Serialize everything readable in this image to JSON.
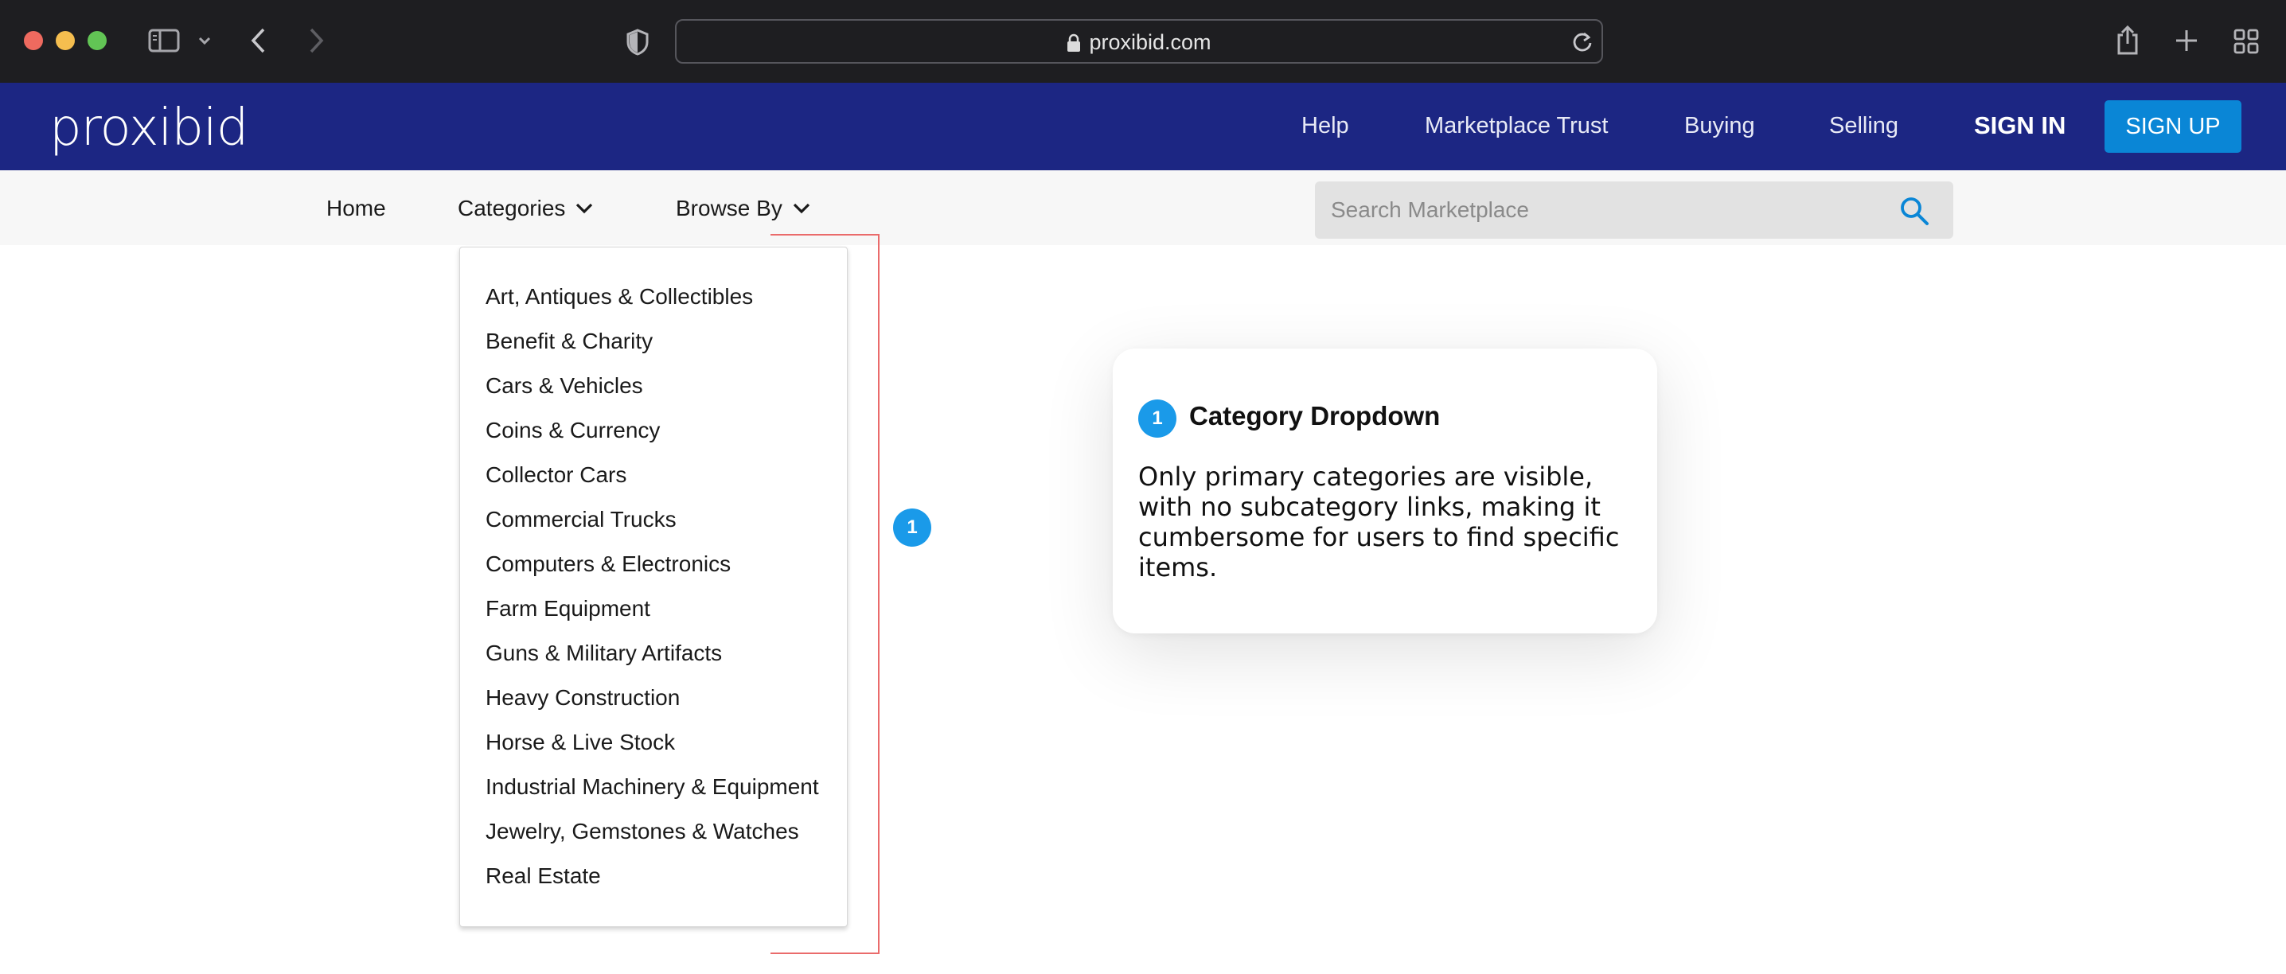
{
  "browser": {
    "url": "proxibid.com",
    "icons": [
      "close-icon",
      "minimize-icon",
      "zoom-icon",
      "sidebar-icon",
      "chevron-down-icon",
      "back-icon",
      "forward-icon",
      "shield-icon",
      "lock-icon",
      "reload-icon",
      "share-icon",
      "new-tab-icon",
      "tab-overview-icon"
    ]
  },
  "header": {
    "logo": "proxibid",
    "nav": [
      "Help",
      "Marketplace Trust",
      "Buying",
      "Selling"
    ],
    "sign_in": "SIGN IN",
    "sign_up": "SIGN UP",
    "background_color": "#1c2683",
    "button_color": "#0a86d6"
  },
  "subnav": {
    "home": "Home",
    "categories": "Categories",
    "browse_by": "Browse By",
    "search_placeholder": "Search Marketplace"
  },
  "dropdown": {
    "items": [
      "Art, Antiques & Collectibles",
      "Benefit & Charity",
      "Cars & Vehicles",
      "Coins & Currency",
      "Collector Cars",
      "Commercial Trucks",
      "Computers & Electronics",
      "Farm Equipment",
      "Guns & Military Artifacts",
      "Heavy Construction",
      "Horse & Live Stock",
      "Industrial Machinery & Equipment",
      "Jewelry, Gemstones & Watches",
      "Real Estate"
    ]
  },
  "annotation": {
    "number": "1",
    "title": "Category Dropdown",
    "body": "Only primary categories are visible, with no subcategory links, making it cumbersome for users to find specific items.",
    "marker_color": "#1a9ae9",
    "bracket_color": "#ea6b6b"
  }
}
